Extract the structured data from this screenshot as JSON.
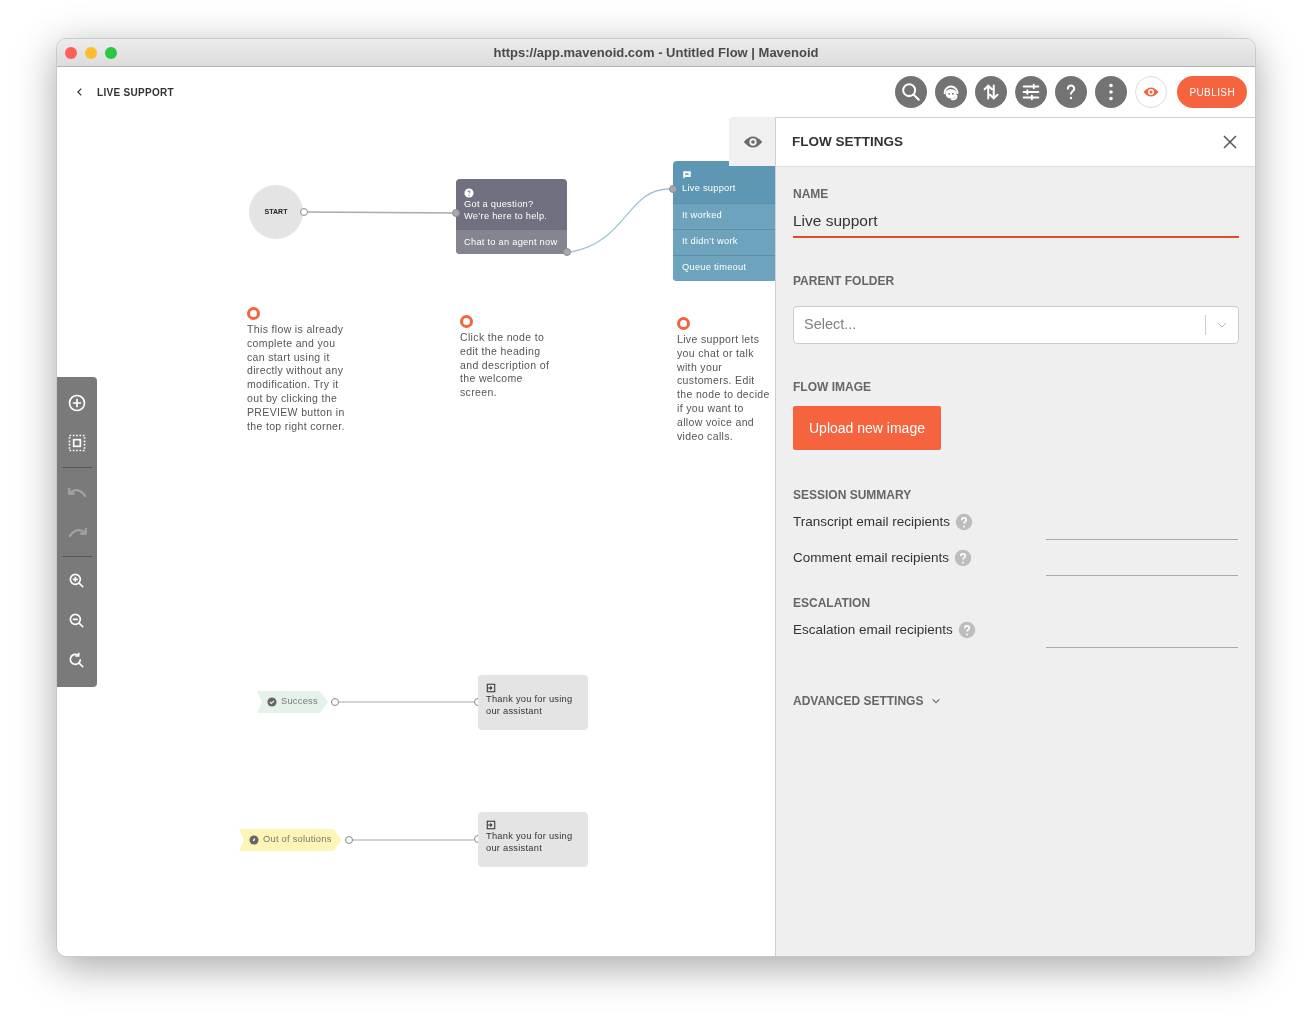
{
  "window": {
    "title": "https://app.mavenoid.com - Untitled Flow | Mavenoid"
  },
  "header": {
    "back_label": "LIVE SUPPORT",
    "tools": [
      {
        "kind": "search"
      },
      {
        "kind": "support"
      },
      {
        "kind": "sort"
      },
      {
        "kind": "sliders"
      },
      {
        "kind": "help"
      },
      {
        "kind": "more"
      }
    ],
    "preview_on": true,
    "publish": "PUBLISH"
  },
  "side_tools": [
    {
      "kind": "add",
      "disabled": false
    },
    {
      "kind": "select",
      "disabled": false
    },
    {
      "kind": "undo",
      "disabled": true
    },
    {
      "kind": "redo",
      "disabled": true
    },
    {
      "kind": "zoom-in",
      "disabled": false
    },
    {
      "kind": "zoom-out",
      "disabled": false
    },
    {
      "kind": "zoom-reset",
      "disabled": false
    }
  ],
  "canvas": {
    "start": "START",
    "question_node": {
      "heading": "Got a question?\nWe’re here to help.",
      "option": "Chat to an agent now"
    },
    "live_node": {
      "title": "Live support",
      "options": [
        "It worked",
        "It didn’t work",
        "Queue timeout"
      ]
    },
    "tips": [
      "This flow is already complete and you can start using it directly without any modification. Try it out by clicking the PREVIEW button in the top right corner.",
      "Click the node to edit the heading and description of the welcome screen.",
      "Live support lets you chat or talk with your customers. Edit the node to decide if you want to allow voice and video calls."
    ],
    "outcomes": [
      {
        "kind": "success",
        "label": "Success",
        "color": "#e4f2e9",
        "end_text": "Thank you for using our assistant"
      },
      {
        "kind": "fail",
        "label": "Out of solutions",
        "color": "#fcf5b5",
        "end_text": "Thank you for using our assistant"
      }
    ]
  },
  "panel": {
    "title": "FLOW SETTINGS",
    "name": {
      "label": "NAME",
      "value": "Live support"
    },
    "parent_folder": {
      "label": "PARENT FOLDER",
      "placeholder": "Select..."
    },
    "flow_image": {
      "label": "FLOW IMAGE",
      "button": "Upload new image"
    },
    "sections": [
      {
        "heading": "SESSION SUMMARY",
        "fields": [
          "Transcript email recipients",
          "Comment email recipients"
        ]
      },
      {
        "heading": "ESCALATION",
        "fields": [
          "Escalation email recipients"
        ]
      }
    ],
    "advanced": {
      "label": "ADVANCED SETTINGS",
      "expanded": false
    }
  }
}
